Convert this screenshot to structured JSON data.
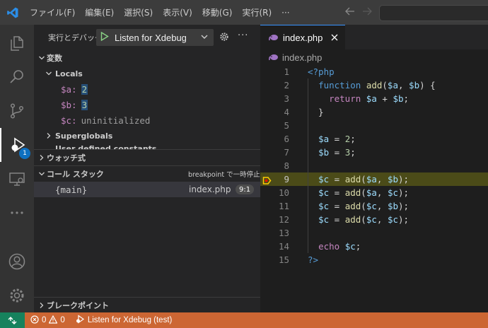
{
  "menu": [
    "ファイル(F)",
    "編集(E)",
    "選択(S)",
    "表示(V)",
    "移動(G)",
    "実行(R)",
    "···"
  ],
  "activity": {
    "debug_badge": "1"
  },
  "sidebar": {
    "run_label": "実行とデバッグ",
    "launch_config": "Listen for Xdebug",
    "more": "···",
    "variables_title": "変数",
    "locals_label": "Locals",
    "variables": [
      {
        "name": "$a:",
        "value": "2",
        "kind": "num"
      },
      {
        "name": "$b:",
        "value": "3",
        "kind": "num"
      },
      {
        "name": "$c:",
        "value": "uninitialized",
        "kind": "uninit"
      }
    ],
    "superglobals_label": "Superglobals",
    "user_constants_label": "User defined constants",
    "watch_title": "ウォッチ式",
    "callstack_title": "コール スタック",
    "callstack_status": "breakpoint で一時停止",
    "callstack": [
      {
        "frame": "{main}",
        "file": "index.php",
        "pos": "9:1"
      }
    ],
    "breakpoints_title": "ブレークポイント"
  },
  "editor": {
    "tab_label": "index.php",
    "breadcrumb": "index.php",
    "current_line": 9,
    "lines": [
      {
        "n": "1",
        "t": "<?php"
      },
      {
        "n": "2",
        "t": "  function add($a, $b) {"
      },
      {
        "n": "3",
        "t": "    return $a + $b;"
      },
      {
        "n": "4",
        "t": "  }"
      },
      {
        "n": "5",
        "t": ""
      },
      {
        "n": "6",
        "t": "  $a = 2;"
      },
      {
        "n": "7",
        "t": "  $b = 3;"
      },
      {
        "n": "8",
        "t": ""
      },
      {
        "n": "9",
        "t": "  $c = add($a, $b);"
      },
      {
        "n": "10",
        "t": "  $c = add($a, $c);"
      },
      {
        "n": "11",
        "t": "  $c = add($c, $b);"
      },
      {
        "n": "12",
        "t": "  $c = add($c, $c);"
      },
      {
        "n": "13",
        "t": ""
      },
      {
        "n": "14",
        "t": "  echo $c;"
      },
      {
        "n": "15",
        "t": "?>"
      }
    ]
  },
  "status": {
    "errors": "0",
    "warnings": "0",
    "debug_session": "Listen for Xdebug (test)"
  },
  "colors": {
    "status_bar": "#cc6633",
    "accent": "#0e70c0",
    "current_line": "#4b4b18"
  }
}
